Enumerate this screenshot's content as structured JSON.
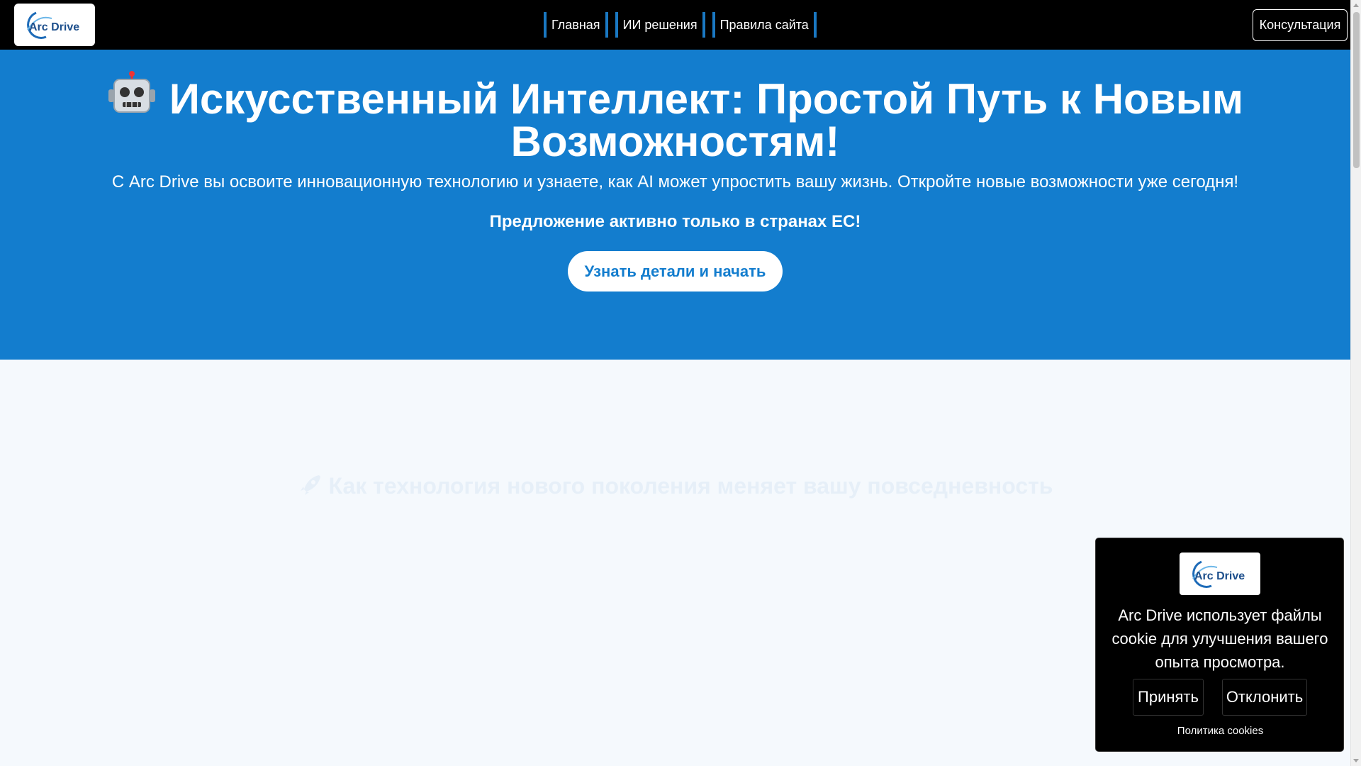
{
  "header": {
    "logo_text": "Arc Drive",
    "nav": [
      {
        "label": "Главная"
      },
      {
        "label": "ИИ решения"
      },
      {
        "label": "Правила сайта"
      }
    ],
    "consult_label": "Консультация"
  },
  "hero": {
    "title": "Искусственный Интеллект: Простой Путь к Новым Возможностям!",
    "subtitle": "С Arc Drive вы освоите инновационную технологию и узнаете, как AI может упростить вашу жизнь. Откройте новые возможности уже сегодня!",
    "offer": "Предложение активно только в странах ЕС!",
    "cta_label": "Узнать детали и начать"
  },
  "section": {
    "title": "Как технология нового поколения меняет вашу повседневность"
  },
  "cookie": {
    "text": "Arc Drive использует файлы cookie для улучшения вашего опыта просмотра.",
    "accept_label": "Принять",
    "decline_label": "Отклонить",
    "policy_label": "Политика cookies"
  },
  "icons": {
    "hero": "robot-icon",
    "section": "rocket-icon"
  },
  "colors": {
    "brand_blue": "#137dce",
    "header_bg": "#000000",
    "nav_accent": "#1a78c2"
  }
}
